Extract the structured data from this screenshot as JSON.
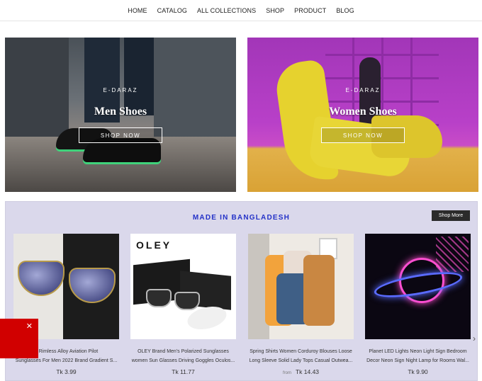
{
  "nav": {
    "items": [
      {
        "label": "HOME"
      },
      {
        "label": "CATALOG"
      },
      {
        "label": "ALL COLLECTIONS"
      },
      {
        "label": "SHOP"
      },
      {
        "label": "PRODUCT"
      },
      {
        "label": "BLOG"
      }
    ]
  },
  "banners": [
    {
      "brand": "E-DARAZ",
      "title": "Men Shoes",
      "button": "SHOP NOW"
    },
    {
      "brand": "E-DARAZ",
      "title": "Women Shoes",
      "button": "SHOP NOW"
    }
  ],
  "collection": {
    "title": "MADE IN BANGLADESH",
    "shop_more": "Shop More",
    "products": [
      {
        "name_line1": "e Rimless Alloy Aviation Pilot",
        "name_line2": "Sunglasses For Men 2022 Brand Gradient S...",
        "price": "Tk 3.99",
        "from": ""
      },
      {
        "name_line1": "OLEY Brand Men's Polarized Sunglasses",
        "name_line2": "women Sun Glasses Driving Goggles Oculos...",
        "price": "Tk 11.77",
        "from": "",
        "brand_text": "OLEY"
      },
      {
        "name_line1": "Spring Shirts Women Corduroy Blouses Loose",
        "name_line2": "Long Sleeve Solid Lady Tops Casual Outwea...",
        "price": "Tk 14.43",
        "from": "from"
      },
      {
        "name_line1": "Planet LED Lights Neon Light Sign Bedroom",
        "name_line2": "Decor Neon Sign Night Lamp for Rooms Wal...",
        "price": "Tk 9.90",
        "from": ""
      }
    ]
  },
  "icons": {
    "next": "chevron-right-icon",
    "close": "close-icon"
  },
  "colors": {
    "accent_title": "#2432c8",
    "collection_bg": "#dad8eb",
    "popup": "#d10000"
  }
}
